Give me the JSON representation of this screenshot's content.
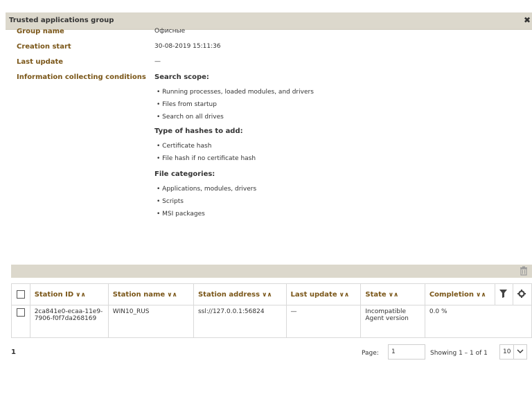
{
  "dialog": {
    "title": "Trusted applications group",
    "close_glyph": "✖"
  },
  "properties": {
    "group_name_label": "Group name",
    "group_name_value": "Офисные",
    "creation_start_label": "Creation start",
    "creation_start_value": "30-08-2019 15:11:36",
    "last_update_label": "Last update",
    "last_update_value": "—",
    "conditions_label": "Information collecting conditions"
  },
  "conditions": {
    "search_scope_heading": "Search scope:",
    "search_scope_items": [
      "• Running processes, loaded modules, and drivers",
      "• Files from startup",
      "• Search on all drives"
    ],
    "hash_types_heading": "Type of hashes to add:",
    "hash_types_items": [
      "• Certificate hash",
      "• File hash if no certificate hash"
    ],
    "file_categories_heading": "File categories:",
    "file_categories_items": [
      "• Applications, modules, drivers",
      "• Scripts",
      "• MSI packages"
    ]
  },
  "table": {
    "sort_glyph": "∨∧",
    "columns": [
      "Station ID",
      "Station name",
      "Station address",
      "Last update",
      "State",
      "Completion"
    ],
    "rows": [
      {
        "station_id": "2ca841e0-ecaa-11e9-7906-f0f7da268169",
        "station_name": "WIN10_RUS",
        "station_address": "ssl://127.0.0.1:56824",
        "last_update": "—",
        "state": "Incompatible Agent version",
        "completion": "0.0 %"
      }
    ]
  },
  "footer": {
    "total_count": "1",
    "page_label": "Page:",
    "page_value": "1",
    "showing": "Showing 1 – 1 of 1",
    "page_size": "10"
  },
  "icons": {
    "trash": "trash-icon",
    "filter": "filter-icon",
    "gear": "gear-icon",
    "close": "close-icon"
  }
}
